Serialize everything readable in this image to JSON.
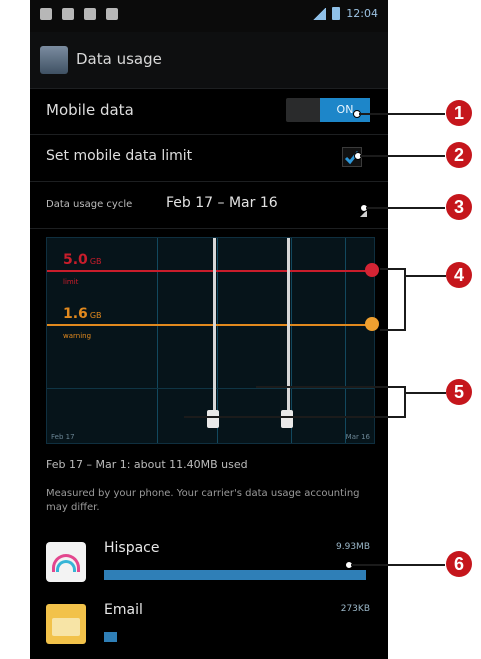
{
  "status_bar": {
    "time": "12:04"
  },
  "app_bar": {
    "title": "Data usage"
  },
  "settings": {
    "mobile_data_label": "Mobile data",
    "mobile_data_toggle": "ON",
    "limit_label": "Set mobile data limit",
    "cycle_label": "Data usage cycle",
    "cycle_value": "Feb 17 – Mar 16"
  },
  "chart": {
    "limit_value": "5.0",
    "limit_unit": "GB",
    "limit_sub": "limit",
    "warning_value": "1.6",
    "warning_unit": "GB",
    "warning_sub": "warning",
    "x_start": "Feb 17",
    "x_end": "Mar 16"
  },
  "summary": "Feb 17 – Mar 1: about 11.40MB used",
  "note": "Measured by your phone. Your carrier's data usage accounting may differ.",
  "apps": [
    {
      "name": "Hispace",
      "size": "9.93MB",
      "bar_fraction": 1.0
    },
    {
      "name": "Email",
      "size": "273KB",
      "bar_fraction": 0.05
    }
  ],
  "callouts": [
    "1",
    "2",
    "3",
    "4",
    "5",
    "6"
  ],
  "colors": {
    "accent": "#1d86c9",
    "limit": "#c81d2b",
    "warning": "#e1891e",
    "callout": "#c5161c"
  }
}
